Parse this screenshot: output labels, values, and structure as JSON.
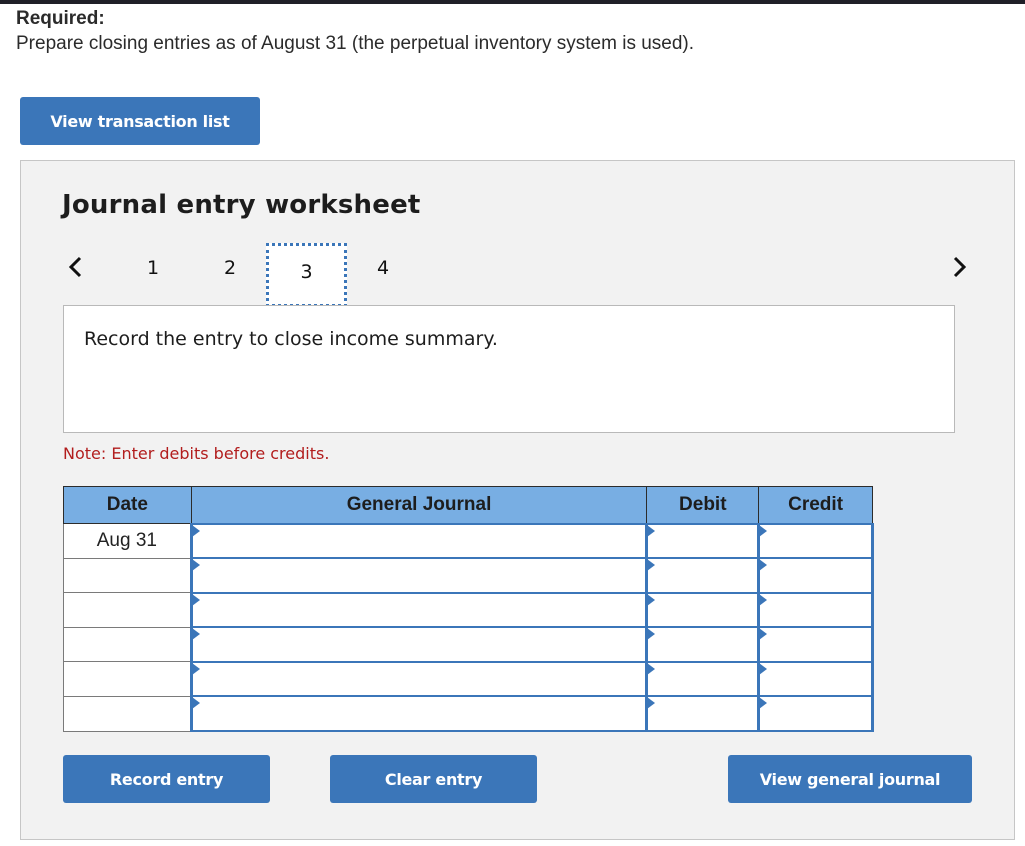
{
  "header": {
    "required_label": "Required:",
    "instruction": "Prepare closing entries as of August 31 (the perpetual inventory system is used)."
  },
  "buttons": {
    "view_transaction_list": "View transaction list",
    "record_entry": "Record entry",
    "clear_entry": "Clear entry",
    "view_general_journal": "View general journal"
  },
  "worksheet": {
    "title": "Journal entry worksheet",
    "pages": [
      "1",
      "2",
      "3",
      "4"
    ],
    "current_page": "3",
    "prev_icon": "chevron-left-icon",
    "next_icon": "chevron-right-icon",
    "prompt": "Record the entry to close income summary.",
    "note": "Note: Enter debits before credits."
  },
  "table": {
    "columns": [
      "Date",
      "General Journal",
      "Debit",
      "Credit"
    ],
    "rows": [
      {
        "date": "Aug 31",
        "account": "",
        "debit": "",
        "credit": ""
      },
      {
        "date": "",
        "account": "",
        "debit": "",
        "credit": ""
      },
      {
        "date": "",
        "account": "",
        "debit": "",
        "credit": ""
      },
      {
        "date": "",
        "account": "",
        "debit": "",
        "credit": ""
      },
      {
        "date": "",
        "account": "",
        "debit": "",
        "credit": ""
      },
      {
        "date": "",
        "account": "",
        "debit": "",
        "credit": ""
      }
    ]
  },
  "colors": {
    "button_blue": "#3b76b9",
    "header_blue": "#78aee3",
    "note_red": "#b21d1d",
    "panel_bg": "#f2f2f2"
  }
}
